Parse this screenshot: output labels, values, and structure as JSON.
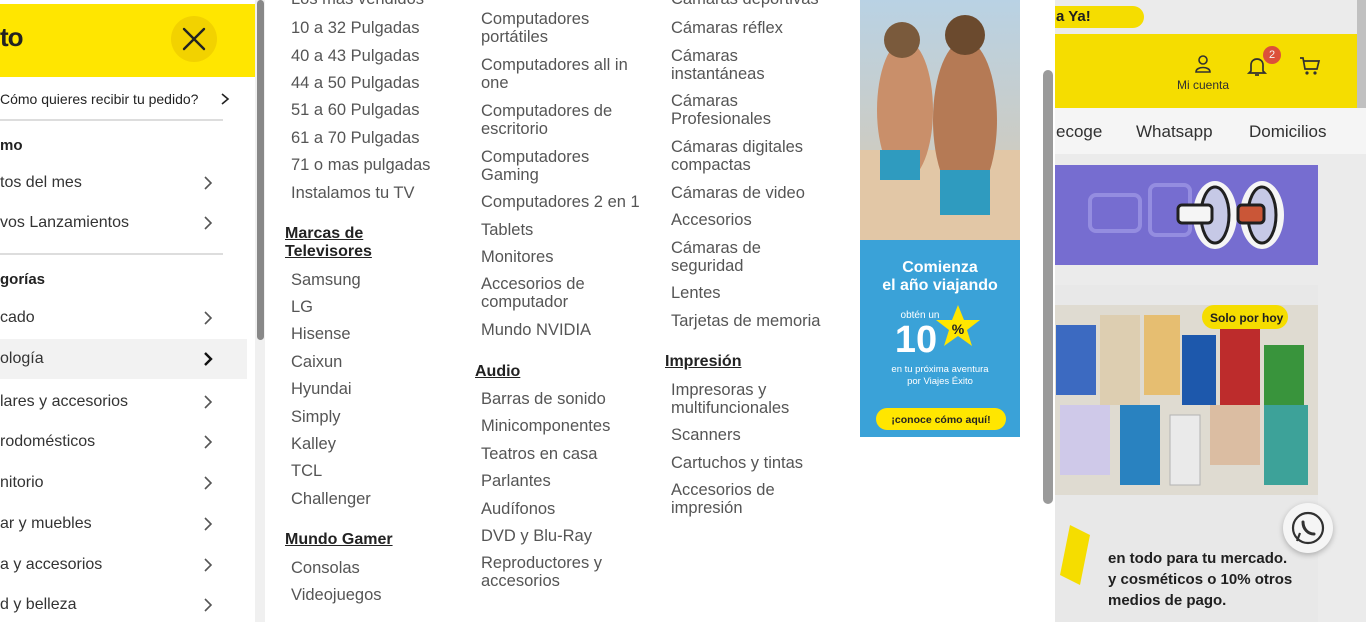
{
  "backdrop": {
    "promo_text": "a Ya!",
    "account_label": "Mi cuenta",
    "notif_count": "2",
    "nav_links": [
      "ecoge",
      "Whatsapp",
      "Domicilios"
    ],
    "promo_lines": [
      "en todo para tu mercado.",
      "y cosméticos o 10% otros",
      "medios de pago."
    ],
    "solo_por_hoy": "Solo por hoy"
  },
  "drawer": {
    "logo": "to",
    "delivery_label": "Cómo quieres recibir tu pedido?",
    "section1_title": "mo",
    "section1_items": [
      {
        "label": "tos del mes"
      },
      {
        "label": "vos Lanzamientos"
      }
    ],
    "section2_title": "gorías",
    "section2_items": [
      {
        "label": "cado",
        "active": false
      },
      {
        "label": "ología",
        "active": true
      },
      {
        "label": "lares y accesorios",
        "active": false
      },
      {
        "label": "rodomésticos",
        "active": false
      },
      {
        "label": "nitorio",
        "active": false
      },
      {
        "label": "ar y muebles",
        "active": false
      },
      {
        "label": "a y accesorios",
        "active": false
      },
      {
        "label": "d y belleza",
        "active": false
      }
    ]
  },
  "mega": {
    "col1": {
      "cut_top": "Los más vendidos",
      "tv_sizes": [
        "10 a 32 Pulgadas",
        "40 a 43 Pulgadas",
        "44 a 50 Pulgadas",
        "51 a 60 Pulgadas",
        "61 a 70 Pulgadas",
        "71 o mas pulgadas",
        "Instalamos tu TV"
      ],
      "brands_title": "Marcas de Televisores",
      "brands": [
        "Samsung",
        "LG",
        "Hisense",
        "Caixun",
        "Hyundai",
        "Simply",
        "Kalley",
        "TCL",
        "Challenger"
      ],
      "gamer_title": "Mundo Gamer",
      "gamer": [
        "Consolas",
        "Videojuegos"
      ]
    },
    "col2": {
      "computers": [
        "Computadores portátiles",
        "Computadores all in one",
        "Computadores de escritorio",
        "Computadores Gaming",
        "Computadores 2 en 1",
        "Tablets",
        "Monitores",
        "Accesorios de computador",
        "Mundo NVIDIA"
      ],
      "audio_title": "Audio",
      "audio": [
        "Barras de sonido",
        "Minicomponentes",
        "Teatros en casa",
        "Parlantes",
        "Audífonos",
        "DVD y Blu-Ray",
        "Reproductores y accesorios"
      ]
    },
    "col3": {
      "cut_top": "Cámaras deportivas",
      "cameras": [
        "Cámaras réflex",
        "Cámaras instantáneas",
        "Cámaras Profesionales",
        "Cámaras digitales compactas",
        "Cámaras de video",
        "Accesorios",
        "Cámaras de seguridad",
        "Lentes",
        "Tarjetas de memoria"
      ],
      "print_title": "Impresión",
      "print": [
        "Impresoras y multifuncionales",
        "Scanners",
        "Cartuchos y tintas",
        "Accesorios de impresión"
      ]
    },
    "ad": {
      "line1": "Comienza",
      "line2": "el año viajando",
      "line3": "obtén un",
      "big": "10",
      "pct": "%",
      "line4": "en tu próxima aventura",
      "line5": "por Viajes Éxito",
      "cta": "¡conoce cómo aquí!"
    }
  },
  "colors": {
    "brand_yellow": "#ffe600",
    "accent_orange": "#f6a23a",
    "badge_red": "#e5543d"
  }
}
